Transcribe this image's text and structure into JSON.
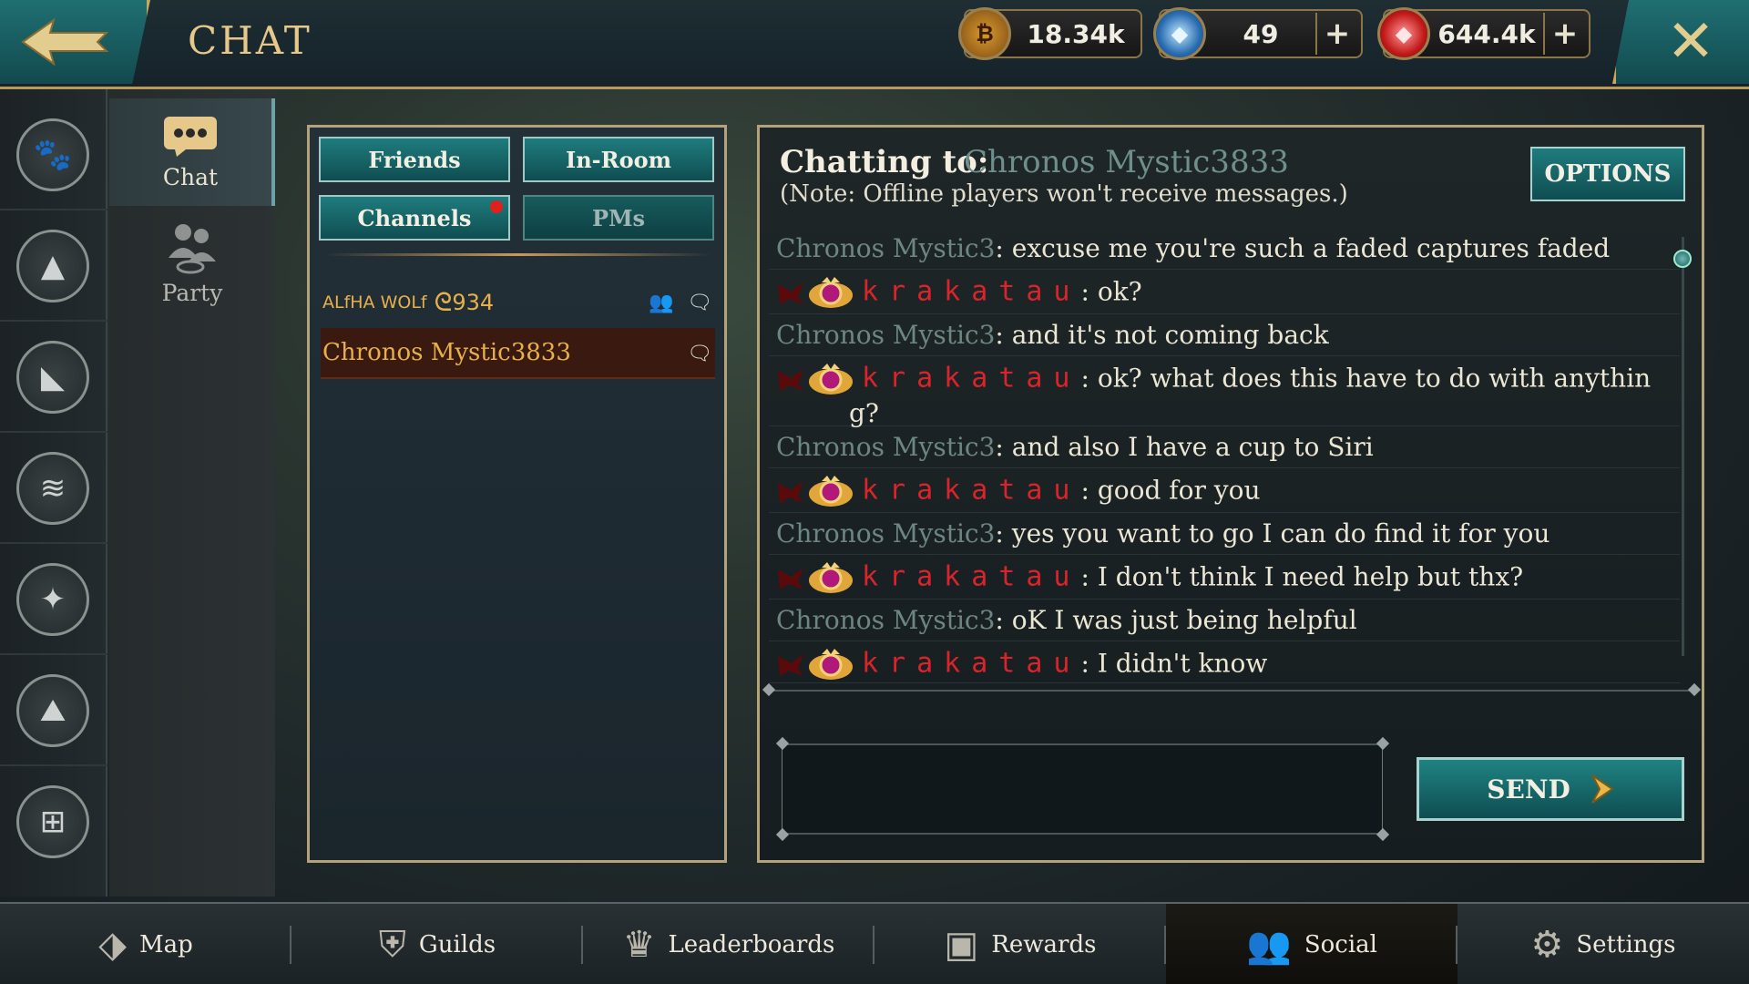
{
  "header": {
    "title": "CHAT",
    "currencies": [
      {
        "icon": "bp-coin-icon",
        "value": "18.34k",
        "has_plus": false
      },
      {
        "icon": "blue-gem-icon",
        "value": "49",
        "has_plus": true
      },
      {
        "icon": "red-gem-icon",
        "value": "644.4k",
        "has_plus": true
      }
    ]
  },
  "subnav": {
    "chat_label": "Chat",
    "party_label": "Party"
  },
  "list_panel": {
    "tabs": {
      "friends": "Friends",
      "in_room": "In-Room",
      "channels": "Channels",
      "pms": "PMs"
    },
    "rows": [
      {
        "name_prefix": "ALfHA WOLf",
        "name_glyph": "ᘓ",
        "name_suffix": "934"
      },
      {
        "name": "Chronos Mystic3833"
      }
    ]
  },
  "chat": {
    "label": "Chatting to:",
    "partner": "Chronos Mystic3833",
    "note": "(Note: Offline players won't receive messages.)",
    "options_label": "OPTIONS",
    "input_value": "",
    "send_label": "SEND",
    "messages": [
      {
        "from": "them",
        "sender": "Chronos Mystic3",
        "text": ": excuse me you're such a faded captures faded"
      },
      {
        "from": "me",
        "sender": "krakatau",
        "text": ": ok?"
      },
      {
        "from": "them",
        "sender": "Chronos Mystic3",
        "text": ": and it's not coming back"
      },
      {
        "from": "me",
        "sender": "krakatau",
        "text": ": ok? what does this have to do with anythin",
        "wrap": "g?"
      },
      {
        "from": "them",
        "sender": "Chronos Mystic3",
        "text": ": and also I have a cup to Siri"
      },
      {
        "from": "me",
        "sender": "krakatau",
        "text": ": good for you"
      },
      {
        "from": "them",
        "sender": "Chronos Mystic3",
        "text": ": yes you want to go I can do find it for you"
      },
      {
        "from": "me",
        "sender": "krakatau",
        "text": ": I don't think I need help but thx?"
      },
      {
        "from": "them",
        "sender": "Chronos Mystic3",
        "text": ": oK I was just being helpful"
      },
      {
        "from": "me",
        "sender": "krakatau",
        "text": ": I didn't know"
      }
    ]
  },
  "bottom_nav": {
    "map": "Map",
    "guilds": "Guilds",
    "leaderboards": "Leaderboards",
    "rewards": "Rewards",
    "social": "Social",
    "settings": "Settings"
  },
  "colors": {
    "accent_teal": "#1f7c7d",
    "gold_trim": "#b4a27a",
    "my_name_red": "#d8242a",
    "their_name": "#6e8682",
    "friend_name_gold": "#e8b04a"
  }
}
